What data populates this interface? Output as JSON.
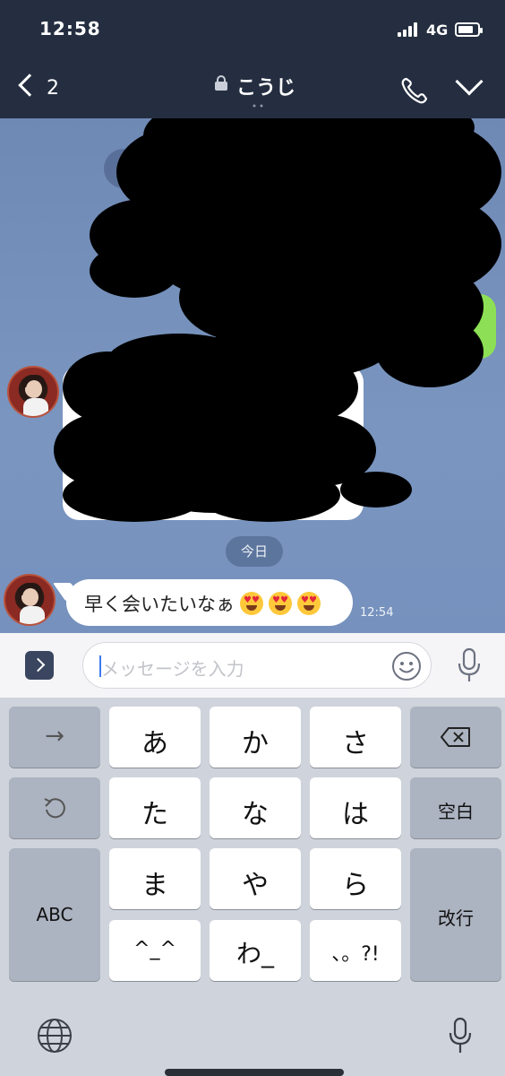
{
  "status_bar": {
    "time": "12:58",
    "network": "4G",
    "signal_level": 4,
    "battery_level": 0.8
  },
  "header": {
    "back_count": "2",
    "title": "こうじ",
    "icons": [
      "chevron-left-icon",
      "lock-icon",
      "phone-icon",
      "chevron-down-icon"
    ]
  },
  "chat": {
    "date_label": "今日",
    "message": {
      "text": "早く会いたいなぁ",
      "emoji": "heart-eyes-emoji",
      "emoji_count": 3,
      "time": "12:54"
    }
  },
  "input": {
    "placeholder": "メッセージを入力",
    "icons": [
      "expand-icon",
      "smile-icon",
      "mic-icon"
    ]
  },
  "keyboard": {
    "keys": {
      "arrow": "→",
      "a": "あ",
      "ka": "か",
      "sa": "さ",
      "undo": "↺",
      "ta": "た",
      "na": "な",
      "ha": "は",
      "space": "空白",
      "abc": "ABC",
      "ma": "ま",
      "ya": "や",
      "ra": "ら",
      "enter": "改行",
      "kaomoji": "^_^",
      "wa": "わ_",
      "punct": "、。?!"
    },
    "icons": [
      "backspace-icon",
      "globe-icon",
      "mic-icon"
    ]
  },
  "colors": {
    "header_bg": "#242e40",
    "chat_bg": "#7a96c0",
    "sent_bubble": "#8de055",
    "keyboard_bg": "#cfd3db"
  }
}
